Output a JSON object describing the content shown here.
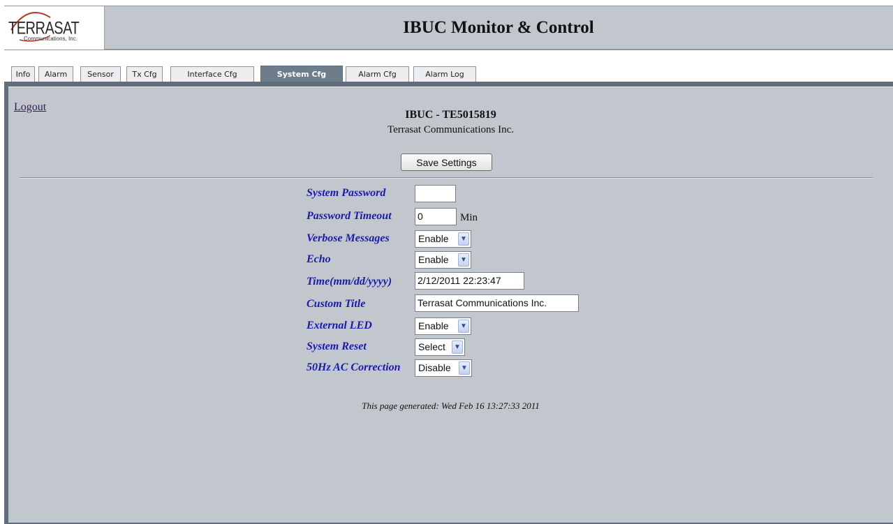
{
  "header": {
    "logo_word": "TERRASAT",
    "logo_sub": "Communications, Inc.",
    "title": "IBUC Monitor & Control"
  },
  "tabs": [
    {
      "label": "Info",
      "active": false
    },
    {
      "label": "Alarm",
      "active": false
    },
    {
      "label": "Sensor",
      "active": false
    },
    {
      "label": "Tx Cfg",
      "active": false
    },
    {
      "label": "Interface Cfg",
      "active": false
    },
    {
      "label": "System Cfg",
      "active": true
    },
    {
      "label": "Alarm Cfg",
      "active": false
    },
    {
      "label": "Alarm Log",
      "active": false
    }
  ],
  "main": {
    "logout_label": "Logout",
    "device_name": "IBUC - TE5015819",
    "company": "Terrasat Communications Inc.",
    "save_label": "Save Settings",
    "generated": "This page generated: Wed Feb 16 13:27:33 2011"
  },
  "form": {
    "system_password": {
      "label": "System Password",
      "value": ""
    },
    "password_timeout": {
      "label": "Password Timeout",
      "value": "0",
      "unit": "Min"
    },
    "verbose_messages": {
      "label": "Verbose Messages",
      "value": "Enable"
    },
    "echo": {
      "label": "Echo",
      "value": "Enable"
    },
    "time": {
      "label": "Time(mm/dd/yyyy)",
      "value": "2/12/2011 22:23:47"
    },
    "custom_title": {
      "label": "Custom Title",
      "value": "Terrasat Communications Inc."
    },
    "external_led": {
      "label": "External LED",
      "value": "Enable"
    },
    "system_reset": {
      "label": "System Reset",
      "value": "Select"
    },
    "ac_correction": {
      "label": "50Hz AC Correction",
      "value": "Disable"
    }
  },
  "colors": {
    "label_blue": "#1a1ab0",
    "panel_bg": "#c1c7cd",
    "active_tab": "#6d7d8a"
  }
}
